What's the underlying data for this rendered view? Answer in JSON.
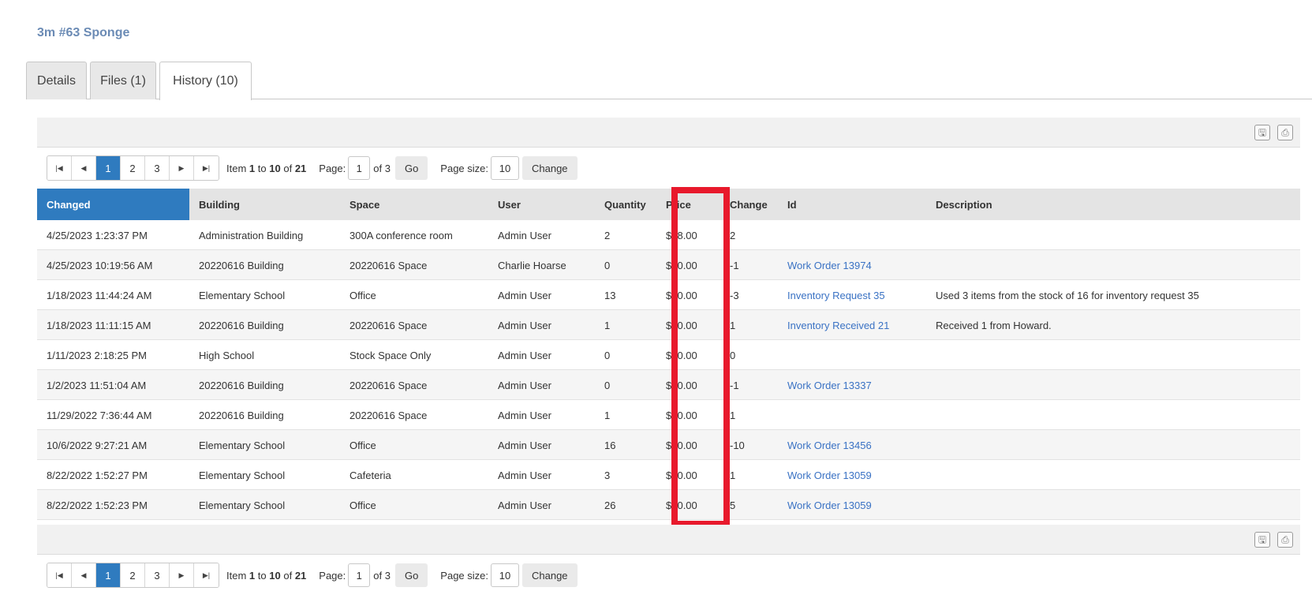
{
  "item_title": "3m #63 Sponge",
  "tabs": [
    {
      "label": "Details",
      "active": false
    },
    {
      "label": "Files (1)",
      "active": false
    },
    {
      "label": "History (10)",
      "active": true
    }
  ],
  "toolbar": {
    "save_icon": "save-icon",
    "print_icon": "print-icon"
  },
  "pager": {
    "pages": [
      "1",
      "2",
      "3"
    ],
    "current_page": "1",
    "info_prefix": "Item",
    "info_from": "1",
    "info_to_word": "to",
    "info_to": "10",
    "info_of_word": "of",
    "info_total": "21",
    "page_label": "Page:",
    "page_value": "1",
    "of_pages": "of 3",
    "go_label": "Go",
    "page_size_label": "Page size:",
    "page_size_value": "10",
    "change_label": "Change"
  },
  "columns": {
    "changed": "Changed",
    "building": "Building",
    "space": "Space",
    "user": "User",
    "quantity": "Quantity",
    "price": "Price",
    "change": "Change",
    "id": "Id",
    "description": "Description"
  },
  "rows": [
    {
      "changed": "4/25/2023 1:23:37 PM",
      "building": "Administration Building",
      "space": "300A conference room",
      "user": "Admin User",
      "quantity": "2",
      "price": "$28.00",
      "change": "2",
      "id": "",
      "description": ""
    },
    {
      "changed": "4/25/2023 10:19:56 AM",
      "building": "20220616 Building",
      "space": "20220616 Space",
      "user": "Charlie Hoarse",
      "quantity": "0",
      "price": "$30.00",
      "change": "-1",
      "id": "Work Order 13974",
      "description": ""
    },
    {
      "changed": "1/18/2023 11:44:24 AM",
      "building": "Elementary School",
      "space": "Office",
      "user": "Admin User",
      "quantity": "13",
      "price": "$30.00",
      "change": "-3",
      "id": "Inventory Request 35",
      "description": "Used 3 items from the stock of 16 for inventory request 35"
    },
    {
      "changed": "1/18/2023 11:11:15 AM",
      "building": "20220616 Building",
      "space": "20220616 Space",
      "user": "Admin User",
      "quantity": "1",
      "price": "$30.00",
      "change": "1",
      "id": "Inventory Received 21",
      "description": "Received 1 from Howard."
    },
    {
      "changed": "1/11/2023 2:18:25 PM",
      "building": "High School",
      "space": "Stock Space Only",
      "user": "Admin User",
      "quantity": "0",
      "price": "$30.00",
      "change": "0",
      "id": "",
      "description": ""
    },
    {
      "changed": "1/2/2023 11:51:04 AM",
      "building": "20220616 Building",
      "space": "20220616 Space",
      "user": "Admin User",
      "quantity": "0",
      "price": "$30.00",
      "change": "-1",
      "id": "Work Order 13337",
      "description": ""
    },
    {
      "changed": "11/29/2022 7:36:44 AM",
      "building": "20220616 Building",
      "space": "20220616 Space",
      "user": "Admin User",
      "quantity": "1",
      "price": "$30.00",
      "change": "1",
      "id": "",
      "description": ""
    },
    {
      "changed": "10/6/2022 9:27:21 AM",
      "building": "Elementary School",
      "space": "Office",
      "user": "Admin User",
      "quantity": "16",
      "price": "$30.00",
      "change": "-10",
      "id": "Work Order 13456",
      "description": ""
    },
    {
      "changed": "8/22/2022 1:52:27 PM",
      "building": "Elementary School",
      "space": "Cafeteria",
      "user": "Admin User",
      "quantity": "3",
      "price": "$30.00",
      "change": "1",
      "id": "Work Order 13059",
      "description": ""
    },
    {
      "changed": "8/22/2022 1:52:23 PM",
      "building": "Elementary School",
      "space": "Office",
      "user": "Admin User",
      "quantity": "26",
      "price": "$30.00",
      "change": "5",
      "id": "Work Order 13059",
      "description": ""
    }
  ],
  "highlight": {
    "column": "price",
    "color": "#e8192c"
  },
  "colors": {
    "accent": "#2f7bbf",
    "link": "#3a72c4",
    "title": "#6b8bb5"
  }
}
